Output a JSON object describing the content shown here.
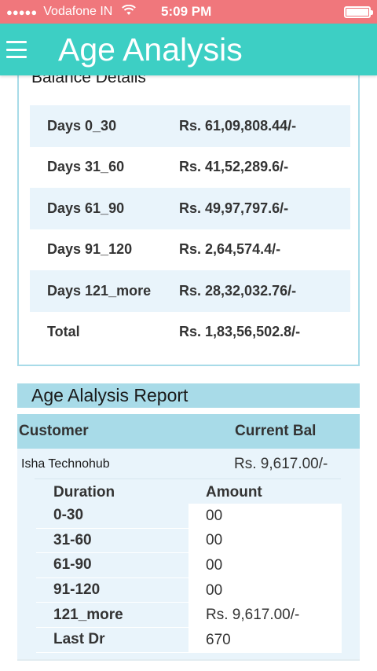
{
  "status_bar": {
    "signal": "●●●●●",
    "carrier": "Vodafone IN",
    "time": "5:09 PM"
  },
  "app_bar": {
    "title": "Age Analysis"
  },
  "balance_details": {
    "header": "Balance Details",
    "rows": [
      {
        "label": "Days   0_30",
        "value": "Rs. 61,09,808.44/-"
      },
      {
        "label": "Days   31_60",
        "value": "Rs. 41,52,289.6/-"
      },
      {
        "label": "Days   61_90",
        "value": "Rs. 49,97,797.6/-"
      },
      {
        "label": "Days   91_120",
        "value": "Rs. 2,64,574.4/-"
      },
      {
        "label": "Days   121_more",
        "value": "Rs. 28,32,032.76/-"
      },
      {
        "label": "Total",
        "value": "Rs. 1,83,56,502.8/-"
      }
    ]
  },
  "report": {
    "header": "Age Alalysis Report",
    "col_customer": "Customer",
    "col_current_bal": "Current Bal",
    "customer": {
      "name": "Isha Technohub",
      "balance": "Rs. 9,617.00/-"
    },
    "col_duration": "Duration",
    "col_amount": "Amount",
    "durations": [
      {
        "label": "0-30",
        "amount": "00"
      },
      {
        "label": "31-60",
        "amount": "00"
      },
      {
        "label": "61-90",
        "amount": "00"
      },
      {
        "label": "91-120",
        "amount": "00"
      },
      {
        "label": "121_more",
        "amount": "Rs. 9,617.00/-"
      },
      {
        "label": "Last Dr",
        "amount": "670"
      }
    ]
  },
  "colors": {
    "status_bar": "#f0777c",
    "app_bar": "#3dcfc4",
    "section_header": "#a8dbe8",
    "row_shade": "#e9f4fb"
  }
}
